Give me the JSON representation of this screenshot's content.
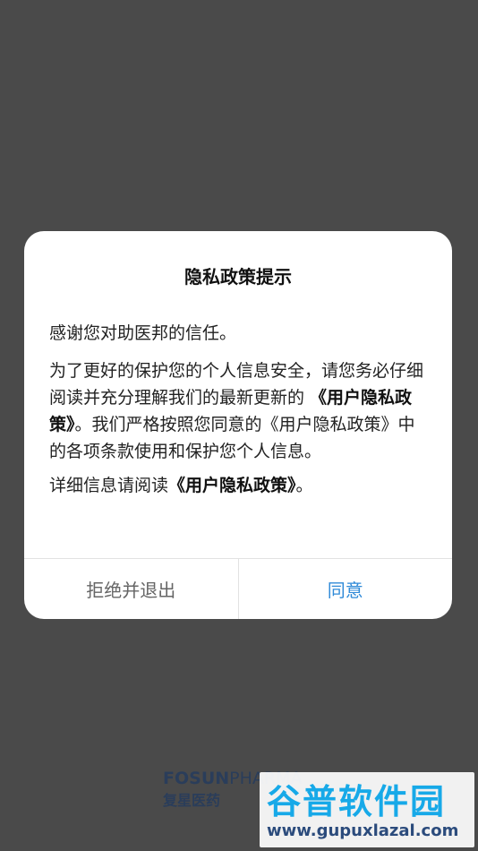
{
  "dialog": {
    "title": "隐私政策提示",
    "paragraphs": {
      "p1": "感谢您对助医邦的信任。",
      "p2_part1": "为了更好的保护您的个人信息安全，请您务必仔细阅读并充分理解我们的最新更新的 ",
      "p2_link": "《用户隐私政策》",
      "p2_part2": "。我们严格按照您同意的《用户隐私政策》中的各项条款使用和保护您个人信息。",
      "p3_part1": "详细信息请阅读",
      "p3_link": "《用户隐私政策》",
      "p3_part2": "。"
    },
    "buttons": {
      "reject_label": "拒绝并退出",
      "agree_label": "同意"
    }
  },
  "background": {
    "brand_en_bold": "FOSUN",
    "brand_en_light": "PHARMA",
    "brand_cn": "复星医药"
  },
  "watermark": {
    "title": "谷普软件园",
    "url": "www.gupuxlazal.com"
  },
  "colors": {
    "overlay": "#4a4a4a",
    "accent": "#2f8ad8",
    "watermark_blue": "#17a9e8"
  }
}
